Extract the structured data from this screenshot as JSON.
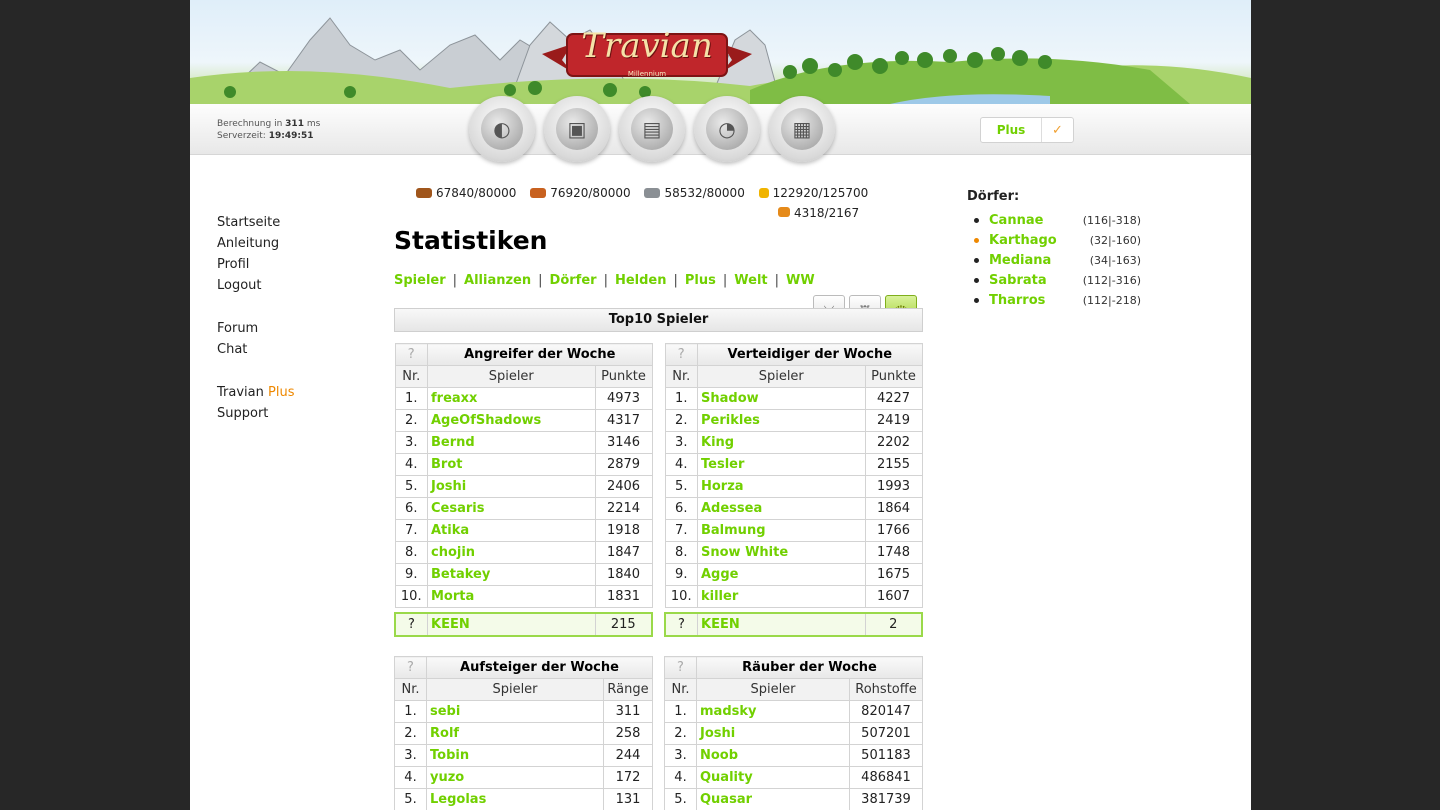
{
  "header": {
    "logo": "Travian",
    "logo_sub": "Millennium",
    "calc_prefix": "Berechnung in",
    "calc_ms": "311",
    "calc_unit": "ms",
    "server_label": "Serverzeit:",
    "server_time": "19:49:51",
    "nav_icons": [
      "village-overview-icon",
      "village-center-icon",
      "map-icon",
      "statistics-icon",
      "reports-icon"
    ],
    "plus_label": "Plus",
    "plus_check": "✓"
  },
  "resources": [
    {
      "icon": "lumber-icon",
      "color": "#a0561c",
      "value": "67840/80000"
    },
    {
      "icon": "clay-icon",
      "color": "#c8611f",
      "value": "76920/80000"
    },
    {
      "icon": "iron-icon",
      "color": "#8a8f94",
      "value": "58532/80000"
    },
    {
      "icon": "crop-icon",
      "color": "#f0b400",
      "value": "122920/125700"
    }
  ],
  "crop_consumption": {
    "icon": "crop-consumption-icon",
    "color": "#e58a1a",
    "value": "4318/2167"
  },
  "leftnav": {
    "home": "Startseite",
    "manual": "Anleitung",
    "profile": "Profil",
    "logout": "Logout",
    "forum": "Forum",
    "chat": "Chat",
    "travian": "Travian",
    "plus": "Plus",
    "support": "Support"
  },
  "page": {
    "title": "Statistiken",
    "tabs": [
      "Spieler",
      "Allianzen",
      "Dörfer",
      "Helden",
      "Plus",
      "Welt",
      "WW"
    ],
    "top10_title": "Top10 Spieler"
  },
  "tables": {
    "attackers": {
      "title": "Angreifer der Woche",
      "q": "?",
      "cols": [
        "Nr.",
        "Spieler",
        "Punkte"
      ],
      "rows": [
        [
          "1.",
          "freaxx",
          "4973"
        ],
        [
          "2.",
          "AgeOfShadows",
          "4317"
        ],
        [
          "3.",
          "Bernd",
          "3146"
        ],
        [
          "4.",
          "Brot",
          "2879"
        ],
        [
          "5.",
          "Joshi",
          "2406"
        ],
        [
          "6.",
          "Cesaris",
          "2214"
        ],
        [
          "7.",
          "Atika",
          "1918"
        ],
        [
          "8.",
          "chojin",
          "1847"
        ],
        [
          "9.",
          "Betakey",
          "1840"
        ],
        [
          "10.",
          "Morta",
          "1831"
        ]
      ],
      "own": [
        "?",
        "KEEN",
        "215"
      ]
    },
    "defenders": {
      "title": "Verteidiger der Woche",
      "q": "?",
      "cols": [
        "Nr.",
        "Spieler",
        "Punkte"
      ],
      "rows": [
        [
          "1.",
          "Shadow",
          "4227"
        ],
        [
          "2.",
          "Perikles",
          "2419"
        ],
        [
          "3.",
          "King",
          "2202"
        ],
        [
          "4.",
          "Tesler",
          "2155"
        ],
        [
          "5.",
          "Horza",
          "1993"
        ],
        [
          "6.",
          "Adessea",
          "1864"
        ],
        [
          "7.",
          "Balmung",
          "1766"
        ],
        [
          "8.",
          "Snow White",
          "1748"
        ],
        [
          "9.",
          "Agge",
          "1675"
        ],
        [
          "10.",
          "killer",
          "1607"
        ]
      ],
      "own": [
        "?",
        "KEEN",
        "2"
      ]
    },
    "climbers": {
      "title": "Aufsteiger der Woche",
      "q": "?",
      "cols": [
        "Nr.",
        "Spieler",
        "Ränge"
      ],
      "rows": [
        [
          "1.",
          "sebi",
          "311"
        ],
        [
          "2.",
          "Rolf",
          "258"
        ],
        [
          "3.",
          "Tobin",
          "244"
        ],
        [
          "4.",
          "yuzo",
          "172"
        ],
        [
          "5.",
          "Legolas",
          "131"
        ]
      ]
    },
    "robbers": {
      "title": "Räuber der Woche",
      "q": "?",
      "cols": [
        "Nr.",
        "Spieler",
        "Rohstoffe"
      ],
      "rows": [
        [
          "1.",
          "madsky",
          "820147"
        ],
        [
          "2.",
          "Joshi",
          "507201"
        ],
        [
          "3.",
          "Noob",
          "501183"
        ],
        [
          "4.",
          "Quality",
          "486841"
        ],
        [
          "5.",
          "Quasar",
          "381739"
        ]
      ]
    }
  },
  "villages": {
    "title": "Dörfer:",
    "items": [
      {
        "name": "Cannae",
        "coords": "(116|-318)",
        "active": false
      },
      {
        "name": "Karthago",
        "coords": "(32|-160)",
        "active": true
      },
      {
        "name": "Mediana",
        "coords": "(34|-163)",
        "active": false
      },
      {
        "name": "Sabrata",
        "coords": "(112|-316)",
        "active": false
      },
      {
        "name": "Tharros",
        "coords": "(112|-218)",
        "active": false
      }
    ]
  }
}
